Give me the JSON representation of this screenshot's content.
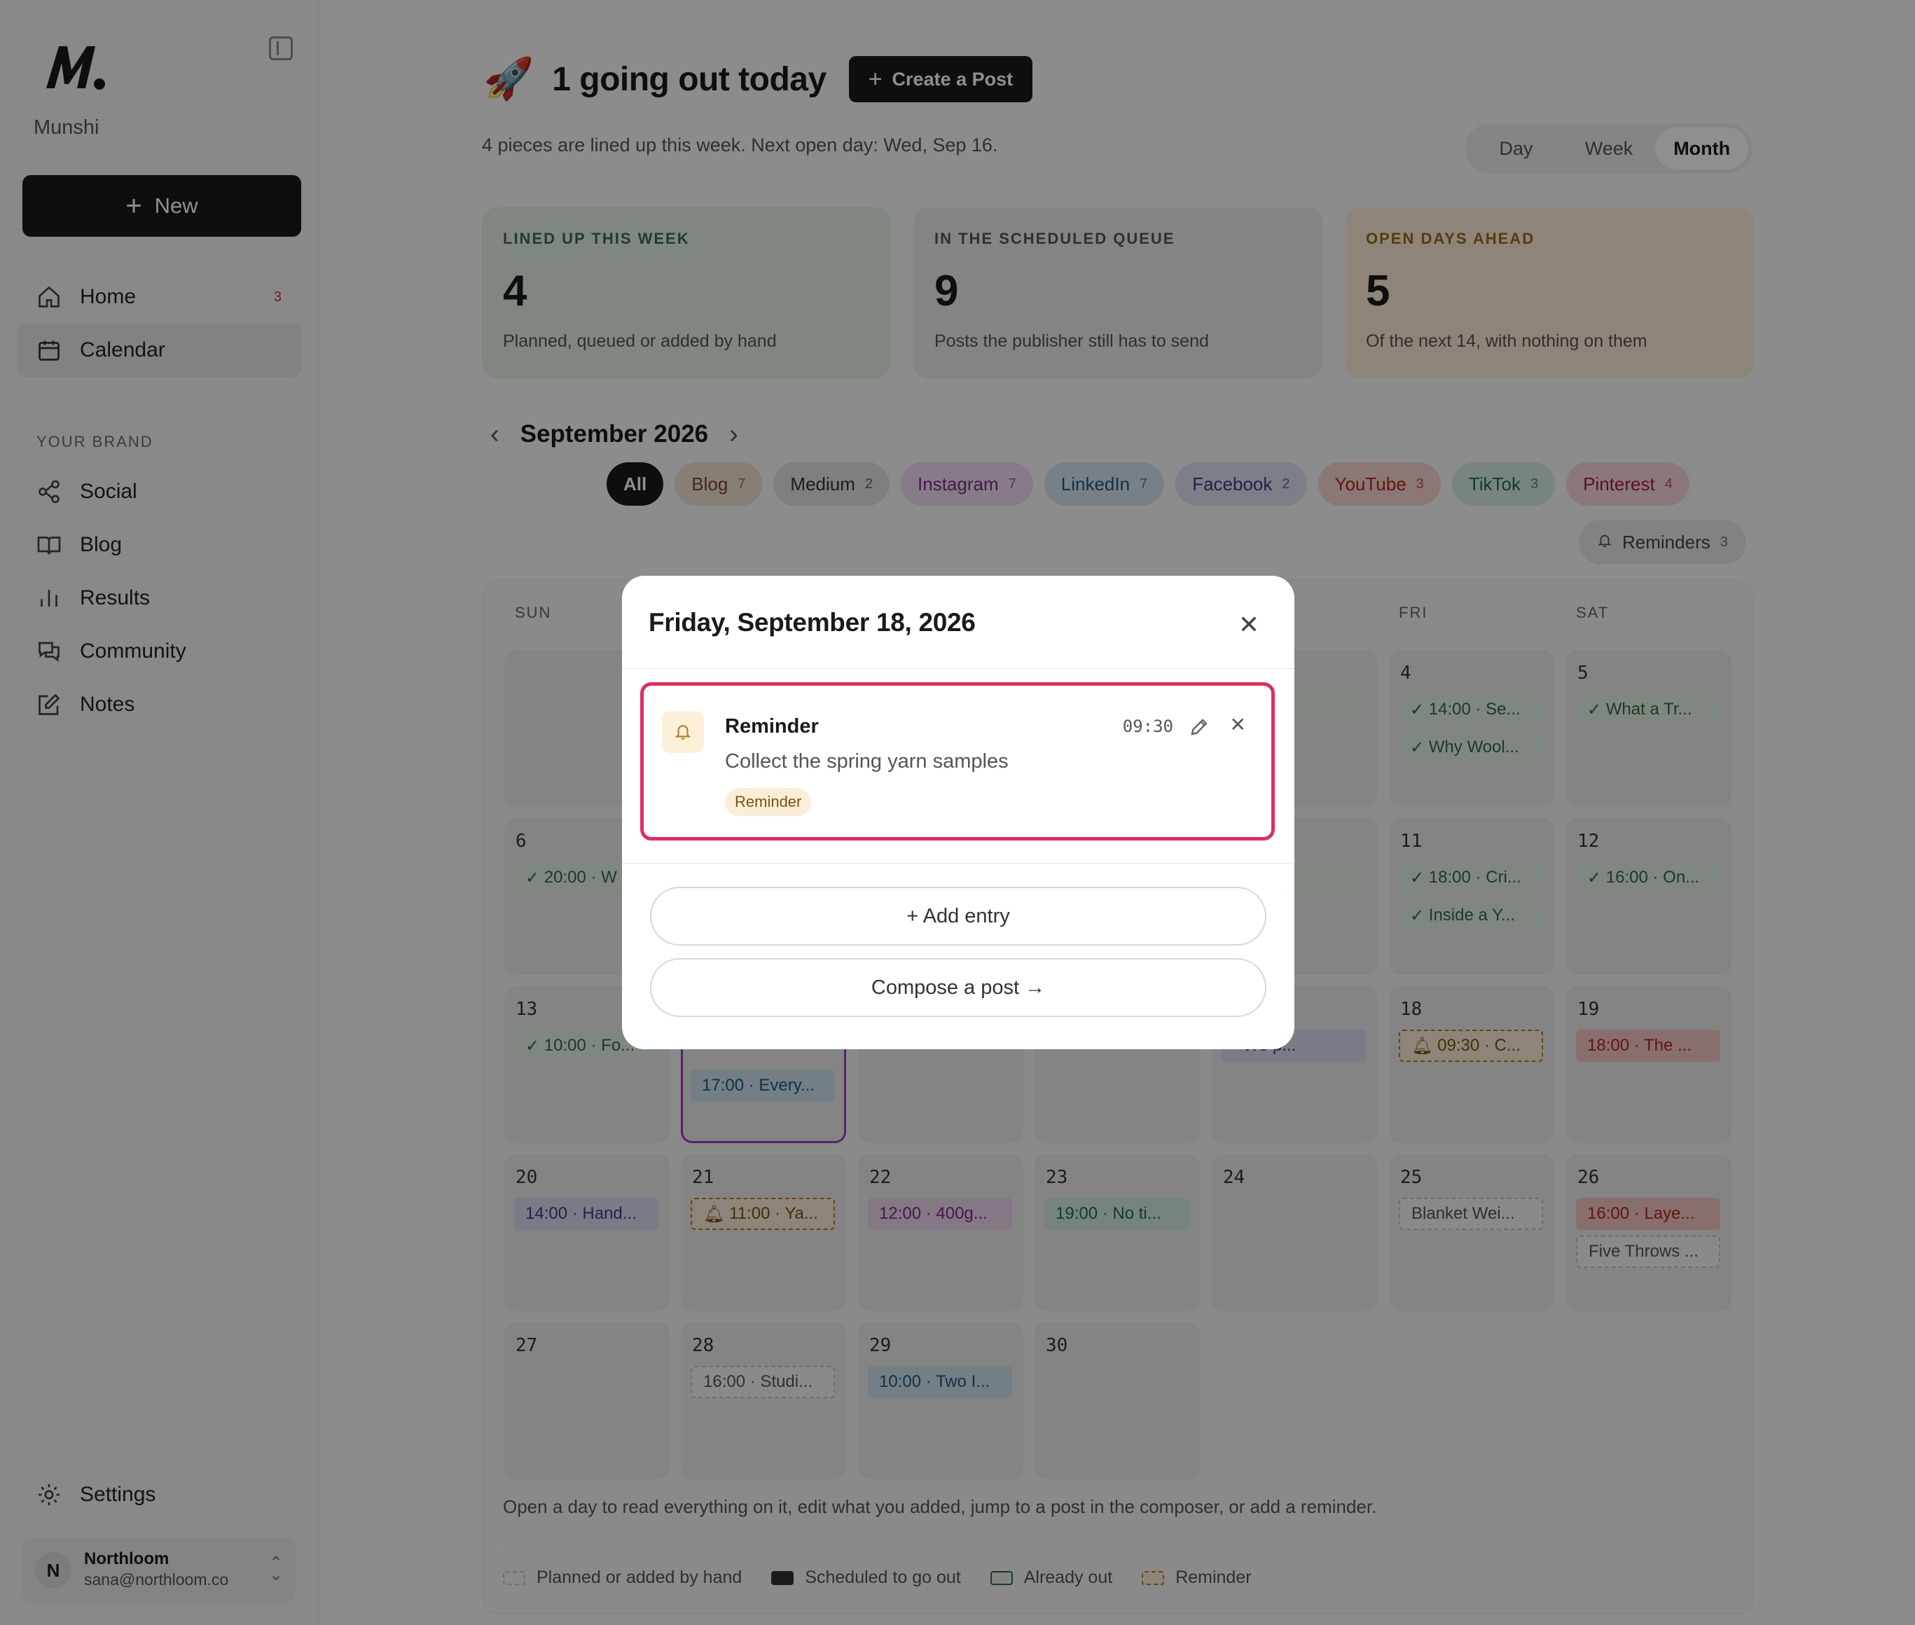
{
  "sidebar": {
    "brand": "Munshi",
    "new_label": "New",
    "nav": [
      {
        "label": "Home",
        "badge": "3"
      },
      {
        "label": "Calendar"
      }
    ],
    "section_label": "YOUR BRAND",
    "brand_nav": [
      {
        "label": "Social"
      },
      {
        "label": "Blog"
      },
      {
        "label": "Results"
      },
      {
        "label": "Community"
      },
      {
        "label": "Notes"
      }
    ],
    "settings_label": "Settings",
    "user": {
      "initial": "N",
      "name": "Northloom",
      "email": "sana@northloom.co"
    }
  },
  "header": {
    "headline": "1 going out today",
    "create_label": "Create a Post",
    "subline": "4 pieces are lined up this week. Next open day: Wed, Sep 16.",
    "views": [
      "Day",
      "Week",
      "Month"
    ],
    "active_view": "Month"
  },
  "stats": [
    {
      "label": "LINED UP THIS WEEK",
      "value": "4",
      "desc": "Planned, queued or added by hand"
    },
    {
      "label": "IN THE SCHEDULED QUEUE",
      "value": "9",
      "desc": "Posts the publisher still has to send"
    },
    {
      "label": "OPEN DAYS AHEAD",
      "value": "5",
      "desc": "Of the next 14, with nothing on them"
    }
  ],
  "calendar": {
    "month_title": "September 2026",
    "filters": [
      {
        "label": "All",
        "count": ""
      },
      {
        "label": "Blog",
        "count": "7"
      },
      {
        "label": "Medium",
        "count": "2"
      },
      {
        "label": "Instagram",
        "count": "7"
      },
      {
        "label": "LinkedIn",
        "count": "7"
      },
      {
        "label": "Facebook",
        "count": "2"
      },
      {
        "label": "YouTube",
        "count": "3"
      },
      {
        "label": "TikTok",
        "count": "3"
      },
      {
        "label": "Pinterest",
        "count": "4"
      }
    ],
    "reminders_label": "Reminders",
    "reminders_count": "3",
    "weekdays": [
      "SUN",
      "FRI",
      "SAT"
    ],
    "days": {
      "d4": "4",
      "d5": "5",
      "d6": "6",
      "d11": "11",
      "d12": "12",
      "d13": "13",
      "d18": "18",
      "d19": "19",
      "d20": "20",
      "d21": "21",
      "d22": "22",
      "d23": "23",
      "d24": "24",
      "d25": "25",
      "d26": "26",
      "d27": "27",
      "d28": "28",
      "d29": "29",
      "d30": "30"
    },
    "entries": {
      "d4a": "14:00 · Se...",
      "d4b": "Why Wool...",
      "d5a": "What a Tr...",
      "d6a": "20:00 · W",
      "d11a": "18:00 · Cri...",
      "d11b": "Inside a Y...",
      "d12a": "16:00 · On...",
      "d13a": "10:00 · Fo...",
      "d14b": "17:00 · Every...",
      "d17a": "· We p...",
      "d18a": "09:30 · C...",
      "d19a": "18:00 · The ...",
      "d20a": "14:00 · Hand...",
      "d21a": "11:00 · Ya...",
      "d22a": "12:00 · 400g...",
      "d23a": "19:00 · No ti...",
      "d25a": "Blanket Wei...",
      "d26a": "16:00 · Laye...",
      "d26b": "Five Throws ...",
      "d28a": "16:00 · Studi...",
      "d29a": "10:00 · Two I...",
      "d3a": ") · Th...",
      "d10a": ") · Ou..."
    },
    "hint": "Open a day to read everything on it, edit what you added, jump to a post in the composer, or add a reminder.",
    "legend": [
      "Planned or added by hand",
      "Scheduled to go out",
      "Already out",
      "Reminder"
    ]
  },
  "modal": {
    "title": "Friday, September 18, 2026",
    "entry": {
      "title": "Reminder",
      "time": "09:30",
      "description": "Collect the spring yarn samples",
      "tag": "Reminder"
    },
    "add_entry_label": "+ Add entry",
    "compose_label": "Compose a post →"
  },
  "colors": {
    "accent_dark": "#1a1a1a",
    "highlight_border": "#dc2f5f",
    "selected_day_border": "#9b3fb8",
    "blog": "#f0e0d2",
    "medium": "#e3e3e3",
    "instagram": "#f1dcf0",
    "linkedin": "#d6e4f0",
    "facebook": "#dde2f3",
    "youtube": "#f6d4d2",
    "tiktok": "#d6ece6",
    "pinterest": "#f6d6da"
  },
  "icons": [
    "logo",
    "sidebar-collapse-icon",
    "plus-icon",
    "home-icon",
    "calendar-icon",
    "share-icon",
    "book-icon",
    "bar-chart-icon",
    "chat-icon",
    "edit-square-icon",
    "gear-icon",
    "chevron-up-down-icon",
    "rocket-icon",
    "chevron-left-icon",
    "chevron-right-icon",
    "bell-icon",
    "check-icon",
    "close-icon",
    "pencil-icon"
  ]
}
